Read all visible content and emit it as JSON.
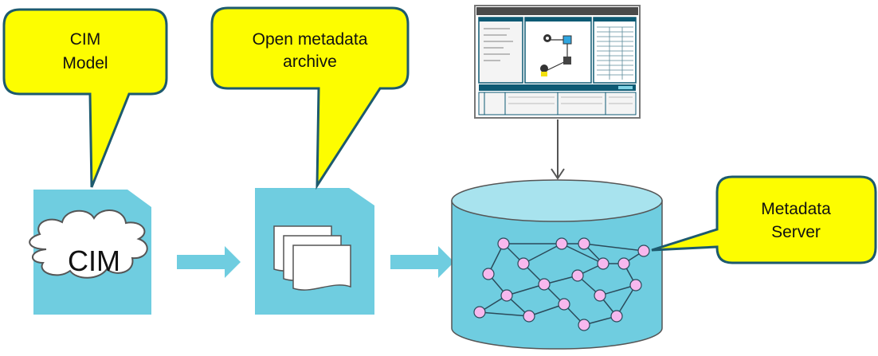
{
  "callouts": {
    "cim_model": {
      "line1": "CIM",
      "line2": "Model"
    },
    "archive": {
      "line1": "Open metadata",
      "line2": "archive"
    },
    "server": {
      "line1": "Metadata",
      "line2": "Server"
    }
  },
  "cloud_label": "CIM",
  "colors": {
    "callout_fill": "#fdfd00",
    "callout_border": "#1d5a6e",
    "document_fill": "#6fcde0",
    "arrow_fill": "#6fcde0",
    "cylinder_fill": "#6fcde0",
    "cylinder_top": "#a8e3ee",
    "node_fill": "#f7b8ee",
    "node_stroke": "#2b4a5a",
    "edge_color": "#2b4a5a",
    "screenshot_header": "#0e5a74",
    "connector": "#555555"
  },
  "icons": [
    "cim-cloud-icon",
    "document-stack-icon",
    "ui-screenshot-thumbnail",
    "graph-network-icon"
  ]
}
